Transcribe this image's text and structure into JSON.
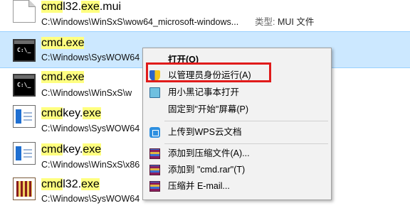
{
  "files": [
    {
      "name_hl": "cmd",
      "name_mid": "l32.",
      "name_hl2": "exe",
      "name_tail": ".mui",
      "path": "C:\\Windows\\WinSxS\\wow64_microsoft-windows...",
      "type_label": "类型:",
      "type_value": "MUI 文件",
      "icon": "document-icon"
    },
    {
      "name_hl": "cmd.exe",
      "path": "C:\\Windows\\SysWOW64",
      "icon": "command-prompt-icon"
    },
    {
      "name_hl": "cmd.exe",
      "path": "C:\\Windows\\WinSxS\\w",
      "icon": "command-prompt-icon"
    },
    {
      "name_hl": "cmd",
      "name_mid": "key.",
      "name_hl2": "exe",
      "path": "C:\\Windows\\SysWOW64",
      "icon": "cmdkey-icon"
    },
    {
      "name_hl": "cmd",
      "name_mid": "key.",
      "name_hl2": "exe",
      "path": "C:\\Windows\\WinSxS\\x86",
      "icon": "cmdkey-icon"
    },
    {
      "name_hl": "cmd",
      "name_mid": "l32.",
      "name_hl2": "exe",
      "path": "C:\\Windows\\SysWOW64",
      "icon": "library-icon"
    }
  ],
  "menu": {
    "open": "打开(O)",
    "run_as_admin": "以管理员身份运行(A)",
    "open_notepad": "用小黑记事本打开",
    "pin_start": "固定到\"开始\"屏幕(P)",
    "upload_wps": "上传到WPS云文档",
    "add_archive": "添加到压缩文件(A)...",
    "add_rar": "添加到 \"cmd.rar\"(T)",
    "compress_email": "压缩并 E-mail..."
  },
  "colors": {
    "selection": "#cce8ff",
    "highlight": "#ffff80",
    "red_box": "#e01b1b"
  }
}
